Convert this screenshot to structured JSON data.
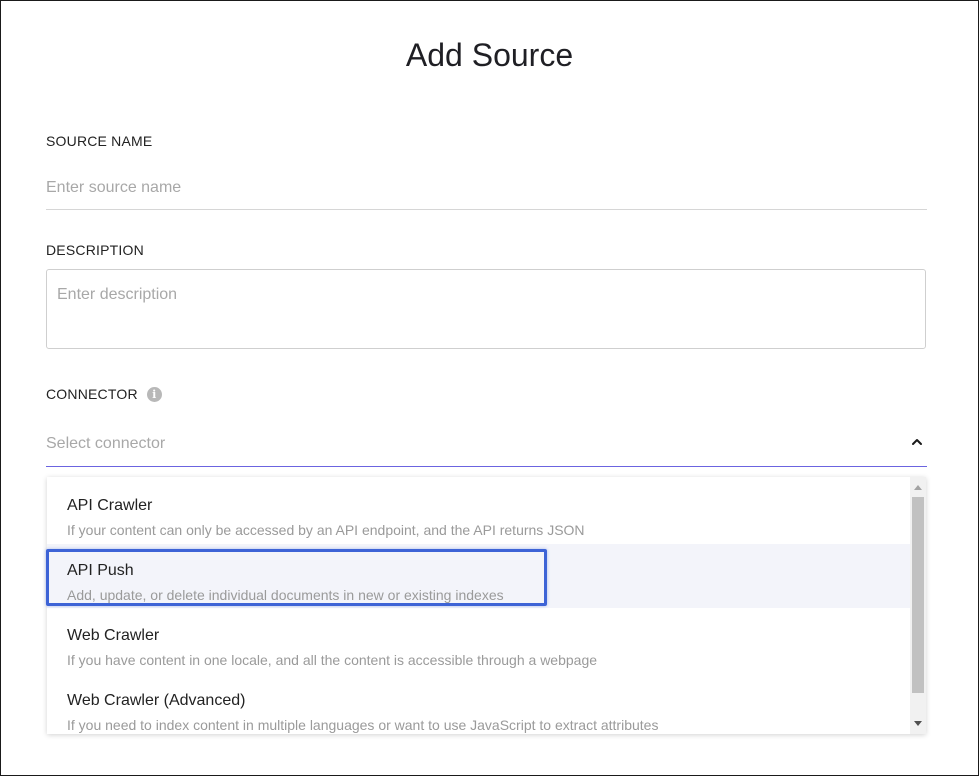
{
  "dialog": {
    "title": "Add Source"
  },
  "fields": {
    "source_name": {
      "label": "SOURCE NAME",
      "placeholder": "Enter source name",
      "value": ""
    },
    "description": {
      "label": "DESCRIPTION",
      "placeholder": "Enter description",
      "value": ""
    },
    "connector": {
      "label": "CONNECTOR",
      "info_icon": "info-icon",
      "placeholder": "Select connector",
      "chevron_icon": "chevron-up-icon",
      "accent_color": "#6b64e0"
    }
  },
  "connector_options": [
    {
      "title": "API Crawler",
      "description": "If your content can only be accessed by an API endpoint, and the API returns JSON"
    },
    {
      "title": "API Push",
      "description": "Add, update, or delete individual documents in new or existing indexes",
      "highlighted": true
    },
    {
      "title": "Web Crawler",
      "description": "If you have content in one locale, and all the content is accessible through a webpage"
    },
    {
      "title": "Web Crawler (Advanced)",
      "description": "If you need to index content in multiple languages or want to use JavaScript to extract attributes"
    }
  ],
  "highlight_color": "#3d63d6"
}
